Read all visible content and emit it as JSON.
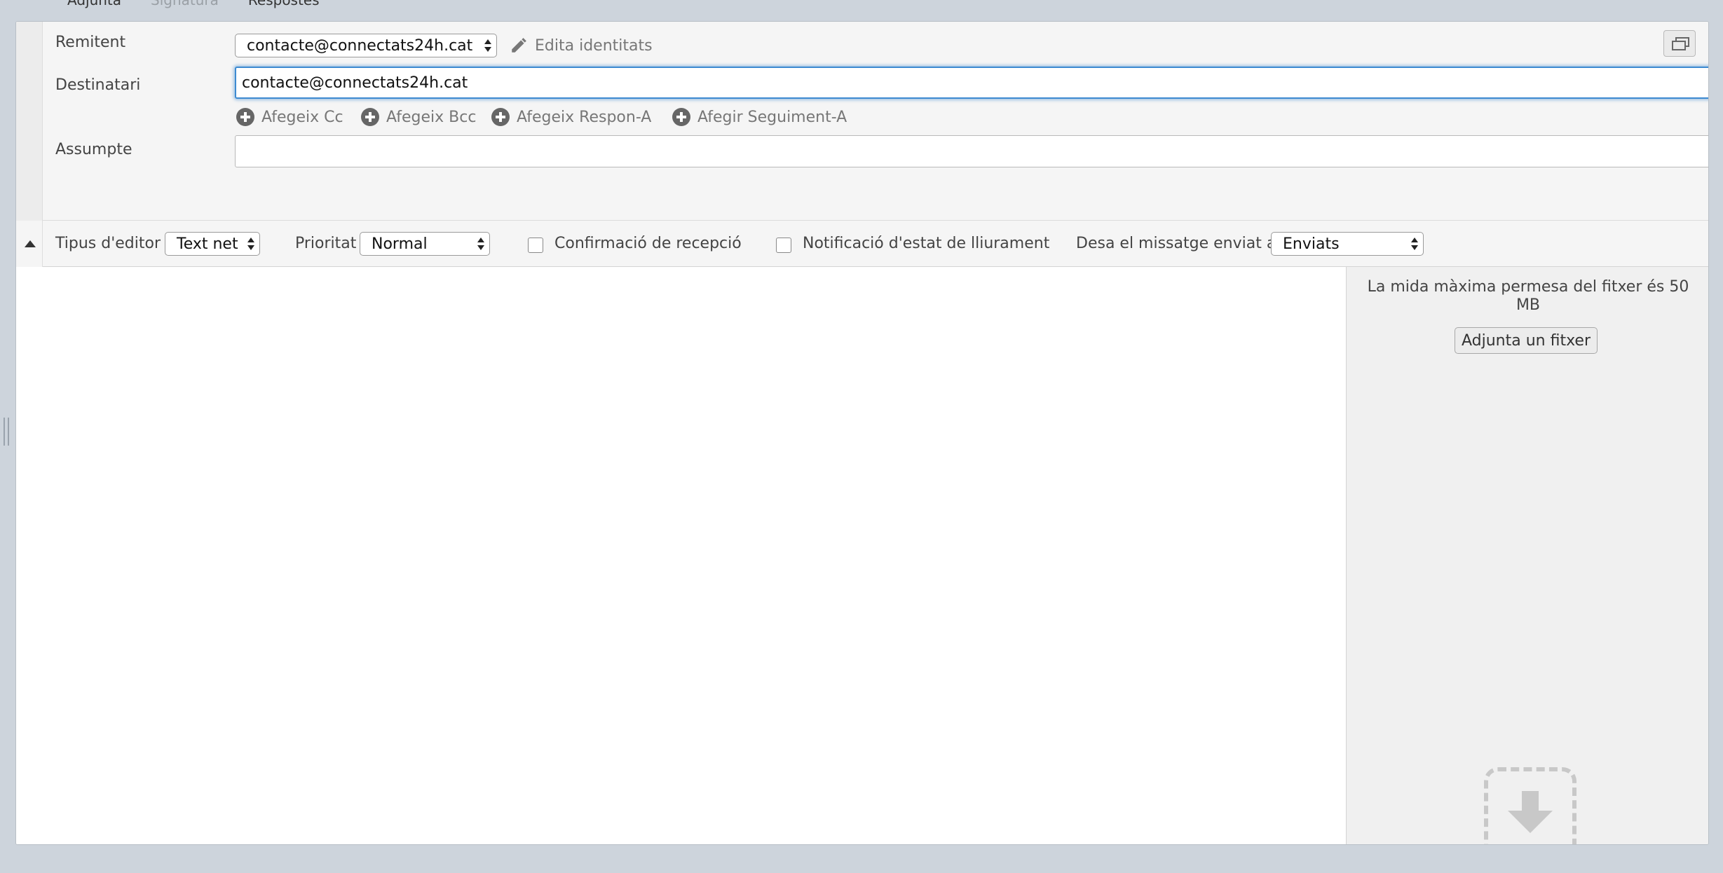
{
  "toolbar": {
    "attach_label": "Adjunta",
    "signature_label": "Signatura",
    "responses_label": "Respostes"
  },
  "compose": {
    "from_label": "Remitent",
    "from_value": "contacte@connectats24h.cat",
    "edit_identities_label": "Edita identitats",
    "to_label": "Destinatari",
    "to_value": "contacte@connectats24h.cat",
    "add_links": [
      "Afegeix Cc",
      "Afegeix Bcc",
      "Afegeix Respon-A",
      "Afegir Seguiment-A"
    ],
    "subject_label": "Assumpte",
    "subject_value": ""
  },
  "options": {
    "editor_type_label": "Tipus d'editor",
    "editor_type_value": "Text net",
    "priority_label": "Prioritat",
    "priority_value": "Normal",
    "receipt_label": "Confirmació de recepció",
    "receipt_checked": false,
    "delivery_label": "Notificació d'estat de lliurament",
    "delivery_checked": false,
    "save_sent_label": "Desa el missatge enviat a",
    "save_sent_value": "Enviats"
  },
  "attachments": {
    "max_size_text": "La mida màxima permesa del fitxer és 50 MB",
    "attach_button_label": "Adjunta un fitxer"
  },
  "icons": {
    "edit": "pencil-icon",
    "add": "plus-circle-icon",
    "collapse": "triangle-up-icon",
    "restore": "window-restore-icon",
    "dropzone": "download-arrow-icon"
  },
  "colors": {
    "focus_ring": "#3d8ad1",
    "page_background": "#cdd4dc"
  }
}
